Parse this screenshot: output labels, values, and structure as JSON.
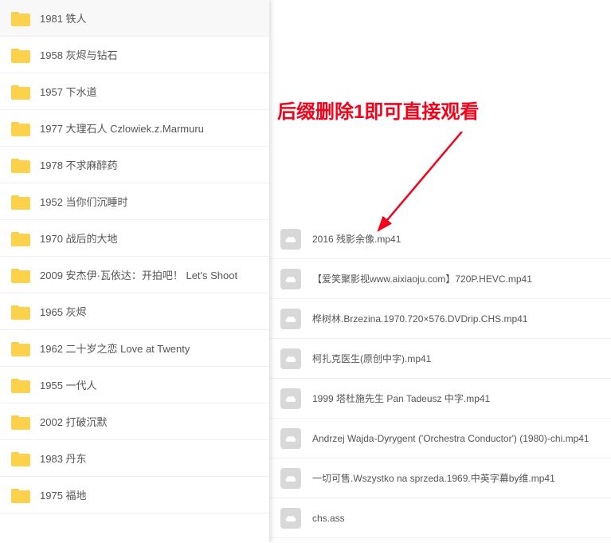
{
  "annotation": "后缀删除1即可直接观看",
  "folders": [
    {
      "label": "1981 铁人"
    },
    {
      "label": "1958 灰烬与钻石"
    },
    {
      "label": "1957 下水道"
    },
    {
      "label": "1977 大理石人 Czlowiek.z.Marmuru"
    },
    {
      "label": "1978 不求麻醉药"
    },
    {
      "label": "1952 当你们沉睡时"
    },
    {
      "label": "1970 战后的大地"
    },
    {
      "label": "2009 安杰伊·瓦依达：开拍吧！ Let's Shoot"
    },
    {
      "label": "1965 灰烬"
    },
    {
      "label": "1962 二十岁之恋 Love at Twenty"
    },
    {
      "label": "1955 一代人"
    },
    {
      "label": "2002 打破沉默"
    },
    {
      "label": "1983 丹东"
    },
    {
      "label": "1975 福地"
    }
  ],
  "files": [
    {
      "label": "2016 残影余像.mp41"
    },
    {
      "label": "【爱笑聚影视www.aixiaoju.com】720P.HEVC.mp41"
    },
    {
      "label": "桦树林.Brzezina.1970.720×576.DVDrip.CHS.mp41"
    },
    {
      "label": "柯扎克医生(原创中字).mp41"
    },
    {
      "label": "1999 塔杜施先生 Pan Tadeusz 中字.mp41"
    },
    {
      "label": "Andrzej Wajda-Dyrygent ('Orchestra Conductor') (1980)-chi.mp41"
    },
    {
      "label": "一切可售.Wszystko na sprzeda.1969.中英字幕by维.mp41"
    },
    {
      "label": "chs.ass"
    }
  ]
}
